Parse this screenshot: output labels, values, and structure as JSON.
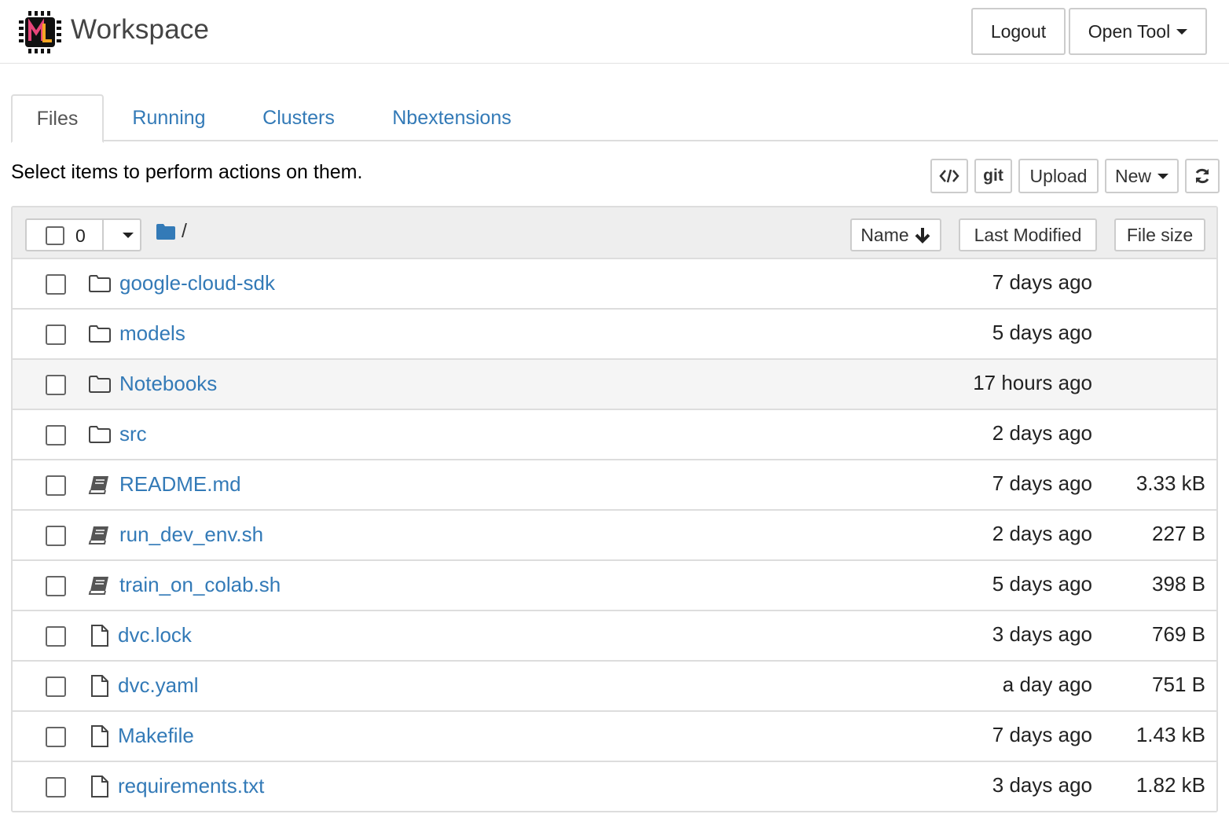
{
  "header": {
    "title": "Workspace",
    "logo_icon": "ml-chip-logo",
    "logout_label": "Logout",
    "open_tool_label": "Open Tool"
  },
  "tabs": [
    {
      "label": "Files",
      "active": true
    },
    {
      "label": "Running",
      "active": false
    },
    {
      "label": "Clusters",
      "active": false
    },
    {
      "label": "Nbextensions",
      "active": false
    }
  ],
  "toolbar": {
    "instruction": "Select items to perform actions on them.",
    "code_icon": "code-icon",
    "git_label": "git",
    "upload_label": "Upload",
    "new_label": "New",
    "refresh_icon": "refresh-icon"
  },
  "list_header": {
    "selected_count": "0",
    "path": "/",
    "sort_name_label": "Name",
    "sort_modified_label": "Last Modified",
    "sort_size_label": "File size"
  },
  "files": [
    {
      "name": "google-cloud-sdk",
      "type": "folder",
      "modified": "7 days ago",
      "size": ""
    },
    {
      "name": "models",
      "type": "folder",
      "modified": "5 days ago",
      "size": ""
    },
    {
      "name": "Notebooks",
      "type": "folder",
      "modified": "17 hours ago",
      "size": ""
    },
    {
      "name": "src",
      "type": "folder",
      "modified": "2 days ago",
      "size": ""
    },
    {
      "name": "README.md",
      "type": "book",
      "modified": "7 days ago",
      "size": "3.33 kB"
    },
    {
      "name": "run_dev_env.sh",
      "type": "book",
      "modified": "2 days ago",
      "size": "227 B"
    },
    {
      "name": "train_on_colab.sh",
      "type": "book",
      "modified": "5 days ago",
      "size": "398 B"
    },
    {
      "name": "dvc.lock",
      "type": "file",
      "modified": "3 days ago",
      "size": "769 B"
    },
    {
      "name": "dvc.yaml",
      "type": "file",
      "modified": "a day ago",
      "size": "751 B"
    },
    {
      "name": "Makefile",
      "type": "file",
      "modified": "7 days ago",
      "size": "1.43 kB"
    },
    {
      "name": "requirements.txt",
      "type": "file",
      "modified": "3 days ago",
      "size": "1.82 kB"
    }
  ],
  "colors": {
    "link": "#337ab7",
    "border": "#dddddd",
    "header_bg": "#eeeeee",
    "hover_row": "#f5f5f5"
  }
}
